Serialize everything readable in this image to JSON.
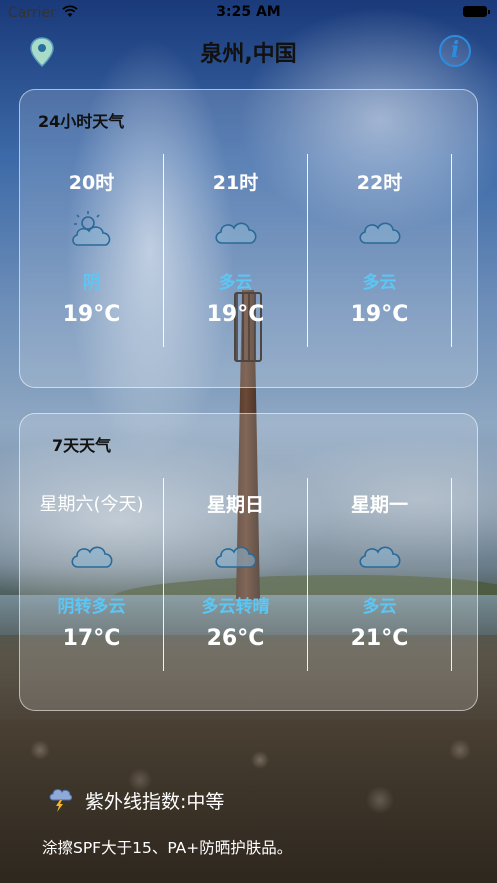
{
  "status_bar": {
    "carrier": "Carrier",
    "time": "3:25 AM"
  },
  "nav": {
    "title": "泉州,中国",
    "info_icon": "i"
  },
  "hourly": {
    "title": "24小时天气",
    "items": [
      {
        "time": "20时",
        "icon": "partly-cloudy-sun-icon",
        "condition": "阴",
        "temp": "19°C"
      },
      {
        "time": "21时",
        "icon": "cloud-icon",
        "condition": "多云",
        "temp": "19°C"
      },
      {
        "time": "22时",
        "icon": "cloud-icon",
        "condition": "多云",
        "temp": "19°C"
      }
    ]
  },
  "daily": {
    "title": "7天天气",
    "items": [
      {
        "day": "星期六(今天)",
        "icon": "cloud-icon",
        "condition": "阴转多云",
        "temp": "17°C"
      },
      {
        "day": "星期日",
        "icon": "cloud-icon",
        "condition": "多云转晴",
        "temp": "26°C"
      },
      {
        "day": "星期一",
        "icon": "cloud-icon",
        "condition": "多云",
        "temp": "21°C"
      }
    ]
  },
  "uv": {
    "icon": "storm-icon",
    "label": "紫外线指数:中等",
    "advice": "涂擦SPF大于15、PA+防晒护肤品。"
  },
  "colors": {
    "condition_text": "#5cc6f5",
    "info_accent": "#2b8de0"
  }
}
